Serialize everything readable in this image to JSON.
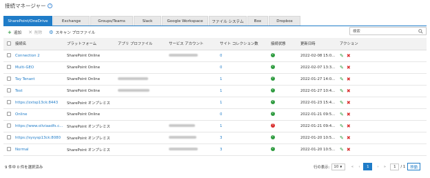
{
  "header": {
    "title": "接続マネージャー"
  },
  "tabs": [
    {
      "label": "SharePoint/OneDrive",
      "active": true
    },
    {
      "label": "Exchange"
    },
    {
      "label": "Groups/Teams"
    },
    {
      "label": "Slack"
    },
    {
      "label": "Google Workspace"
    },
    {
      "label": "ファイル システム"
    },
    {
      "label": "Box"
    },
    {
      "label": "Dropbox"
    }
  ],
  "toolbar": {
    "add_label": "追加",
    "delete_label": "削除",
    "scan_label": "スキャン プロファイル"
  },
  "search": {
    "placeholder": "検索"
  },
  "table": {
    "columns": [
      "接続名",
      "プラットフォーム",
      "アプリ プロファイル",
      "サービス アカウント",
      "サイト コレクション数",
      "接続状態",
      "更新日時",
      "アクション"
    ],
    "rows": [
      {
        "name": "Connection 2",
        "platform": "SharePoint Online",
        "sites": "0",
        "status": "ok",
        "updated": "2022-02-08 15:0..."
      },
      {
        "name": "Multi-GEO",
        "platform": "SharePoint Online",
        "sites": "0",
        "status": "ok",
        "updated": "2022-02-07 13:3..."
      },
      {
        "name": "Tay Tenant",
        "platform": "SharePoint Online",
        "sites": "1",
        "status": "ok",
        "updated": "2022-01-27 14:0..."
      },
      {
        "name": "Test",
        "platform": "SharePoint Online",
        "sites": "1",
        "status": "ok",
        "updated": "2022-01-27 10:4..."
      },
      {
        "name": "https://zxtsp13ck:8443",
        "platform": "SharePoint オンプレミス",
        "sites": "1",
        "status": "ok",
        "updated": "2022-01-23 15:4..."
      },
      {
        "name": "Online",
        "platform": "SharePoint Online",
        "sites": "0",
        "status": "ok",
        "updated": "2022-01-21 09:5..."
      },
      {
        "name": "https://www.oliviaadfs.c...",
        "platform": "SharePoint オンプレミス",
        "sites": "1",
        "status": "error",
        "updated": "2022-01-21 09:4..."
      },
      {
        "name": "https://sysysp13ck:8080",
        "platform": "SharePoint オンプレミス",
        "sites": "3",
        "status": "ok",
        "updated": "2022-01-20 10:5..."
      },
      {
        "name": "Normal",
        "platform": "SharePoint オンプレミス",
        "sites": "3",
        "status": "ok",
        "updated": "2022-01-20 10:5..."
      }
    ]
  },
  "footer": {
    "selection_text": "9 件中 0 件を選択済み",
    "rows_per_page_label": "行の表示:",
    "rows_per_page": "10",
    "current_page": "1",
    "page_input": "1",
    "total_pages": "/ 1",
    "move_label": "移動"
  },
  "colors": {
    "accent": "#1f7cc8",
    "ok": "#2e9b3f",
    "error": "#d9302f"
  }
}
